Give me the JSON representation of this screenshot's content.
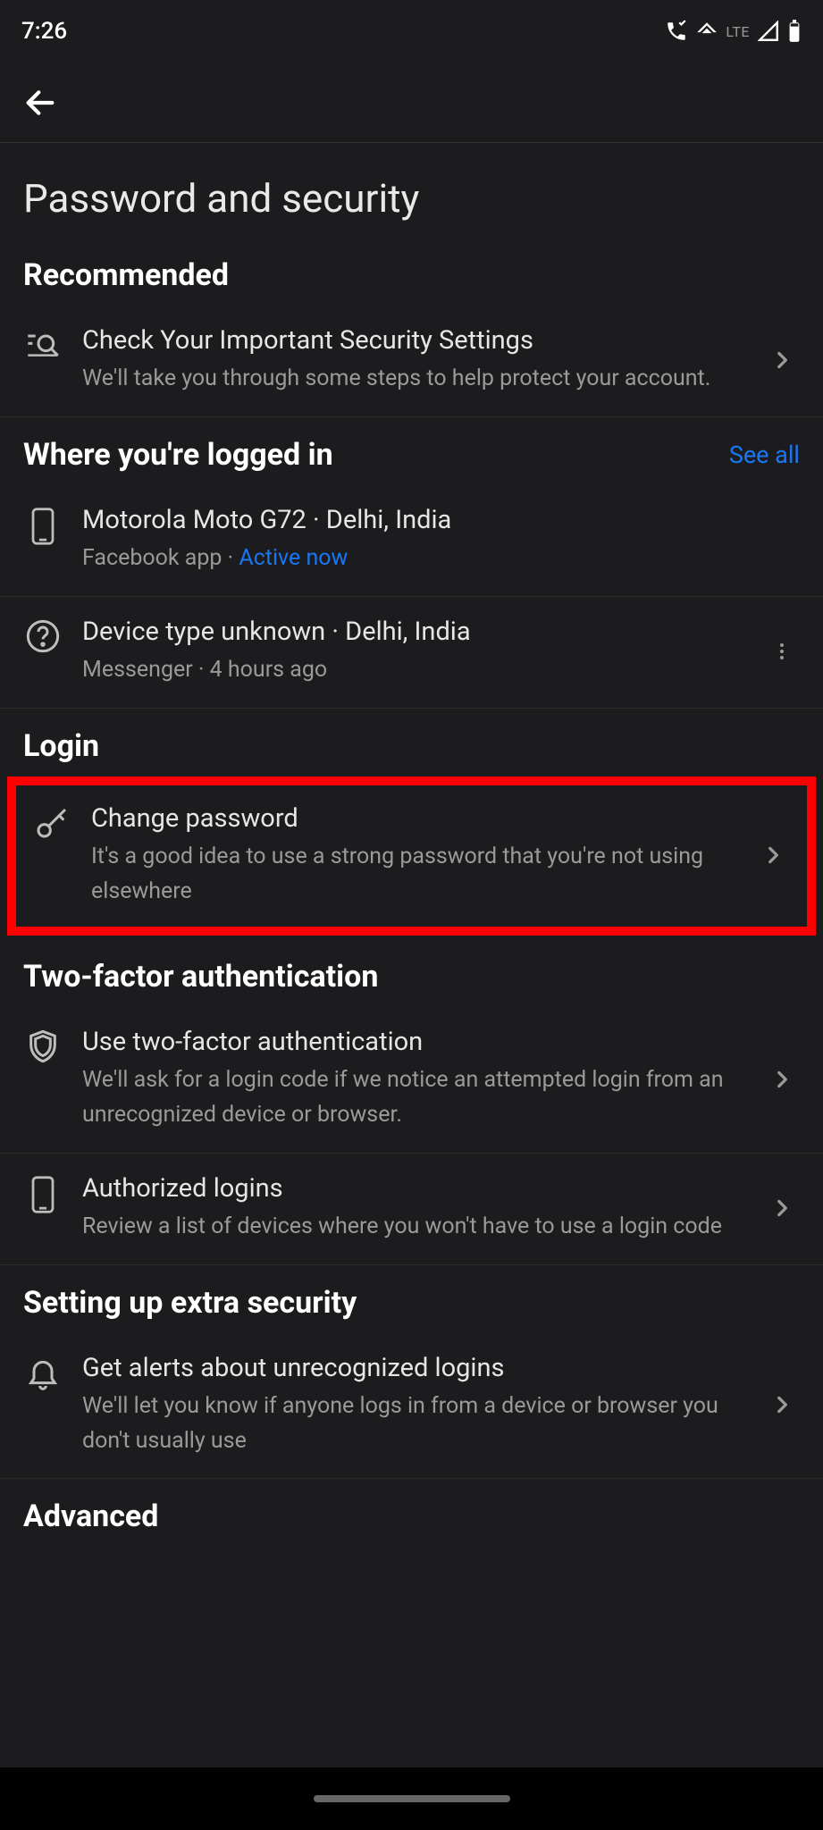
{
  "status": {
    "time": "7:26",
    "lte": "LTE"
  },
  "page": {
    "title": "Password and security"
  },
  "sections": {
    "recommended": {
      "header": "Recommended",
      "check": {
        "title": "Check Your Important Security Settings",
        "sub": "We'll take you through some steps to help protect your account."
      }
    },
    "where": {
      "header": "Where you're logged in",
      "see_all": "See all",
      "d0": {
        "title": "Motorola Moto G72 · Delhi, India",
        "sub_app": "Facebook app · ",
        "sub_active": "Active now"
      },
      "d1": {
        "title": "Device type unknown · Delhi, India",
        "sub": "Messenger · 4 hours ago"
      }
    },
    "login": {
      "header": "Login",
      "change": {
        "title": "Change password",
        "sub": "It's a good idea to use a strong password that you're not using elsewhere"
      }
    },
    "twofa": {
      "header": "Two-factor authentication",
      "use": {
        "title": "Use two-factor authentication",
        "sub": "We'll ask for a login code if we notice an attempted login from an unrecognized device or browser."
      },
      "auth": {
        "title": "Authorized logins",
        "sub": "Review a list of devices where you won't have to use a login code"
      }
    },
    "extra": {
      "header": "Setting up extra security",
      "alerts": {
        "title": "Get alerts about unrecognized logins",
        "sub": "We'll let you know if anyone logs in from a device or browser you don't usually use"
      }
    },
    "advanced": {
      "header": "Advanced"
    }
  }
}
